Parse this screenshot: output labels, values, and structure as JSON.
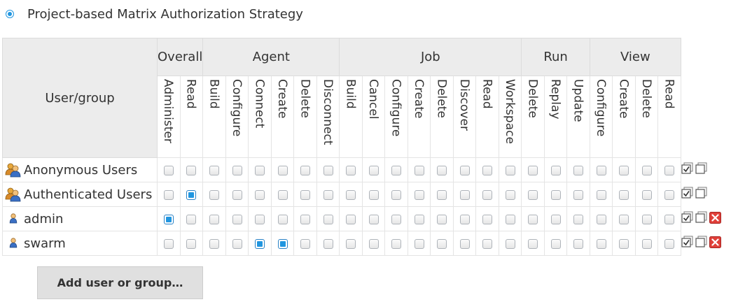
{
  "strategy": {
    "label": "Project-based Matrix Authorization Strategy",
    "selected": true,
    "accent_color": "#2196e0"
  },
  "matrix": {
    "user_group_header": "User/group",
    "groups": [
      {
        "label": "Overall",
        "permissions": [
          "Administer",
          "Read"
        ]
      },
      {
        "label": "Agent",
        "permissions": [
          "Build",
          "Configure",
          "Connect",
          "Create",
          "Delete",
          "Disconnect"
        ]
      },
      {
        "label": "Job",
        "permissions": [
          "Build",
          "Cancel",
          "Configure",
          "Create",
          "Delete",
          "Discover",
          "Read",
          "Workspace"
        ]
      },
      {
        "label": "Run",
        "permissions": [
          "Delete",
          "Replay",
          "Update"
        ]
      },
      {
        "label": "View",
        "permissions": [
          "Configure",
          "Create",
          "Delete",
          "Read"
        ]
      }
    ],
    "rows": [
      {
        "name": "Anonymous Users",
        "icon": "user-group-icon",
        "checked": [],
        "removable": false
      },
      {
        "name": "Authenticated Users",
        "icon": "user-group-icon",
        "checked": [
          1
        ],
        "removable": false
      },
      {
        "name": "admin",
        "icon": "user-icon",
        "checked": [
          0
        ],
        "removable": true
      },
      {
        "name": "swarm",
        "icon": "user-icon",
        "checked": [
          4,
          5
        ],
        "removable": true
      }
    ]
  },
  "add_button": {
    "label": "Add user or group…"
  }
}
